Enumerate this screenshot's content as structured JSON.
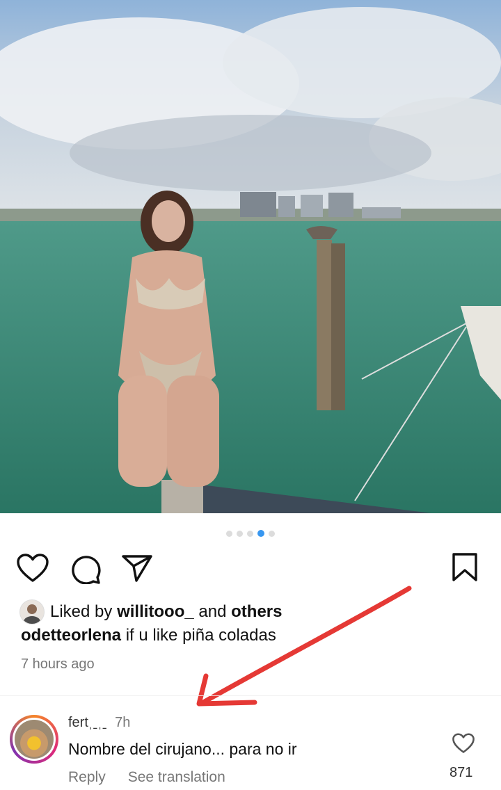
{
  "post": {
    "carousel": {
      "count": 5,
      "active_index": 3
    },
    "liked_by_prefix": "Liked by",
    "liked_by_user": "willitooo_",
    "liked_by_and": "and",
    "liked_by_others": "others",
    "caption_user": "odetteorlena",
    "caption_text": "if u like piña coladas",
    "time_ago": "7 hours ago"
  },
  "comment": {
    "username": "fertˌˍˌˍ",
    "time": "7h",
    "text": "Nombre del cirujano... para no ir",
    "reply_label": "Reply",
    "translate_label": "See translation",
    "like_count": "871"
  },
  "icons": {
    "like": "heart-icon",
    "comment": "comment-bubble-icon",
    "share": "paper-plane-icon",
    "save": "bookmark-icon",
    "annotation": "red-arrow"
  },
  "colors": {
    "accent_dot": "#3897f0",
    "annotation_red": "#e53935",
    "secondary_text": "#777777"
  }
}
